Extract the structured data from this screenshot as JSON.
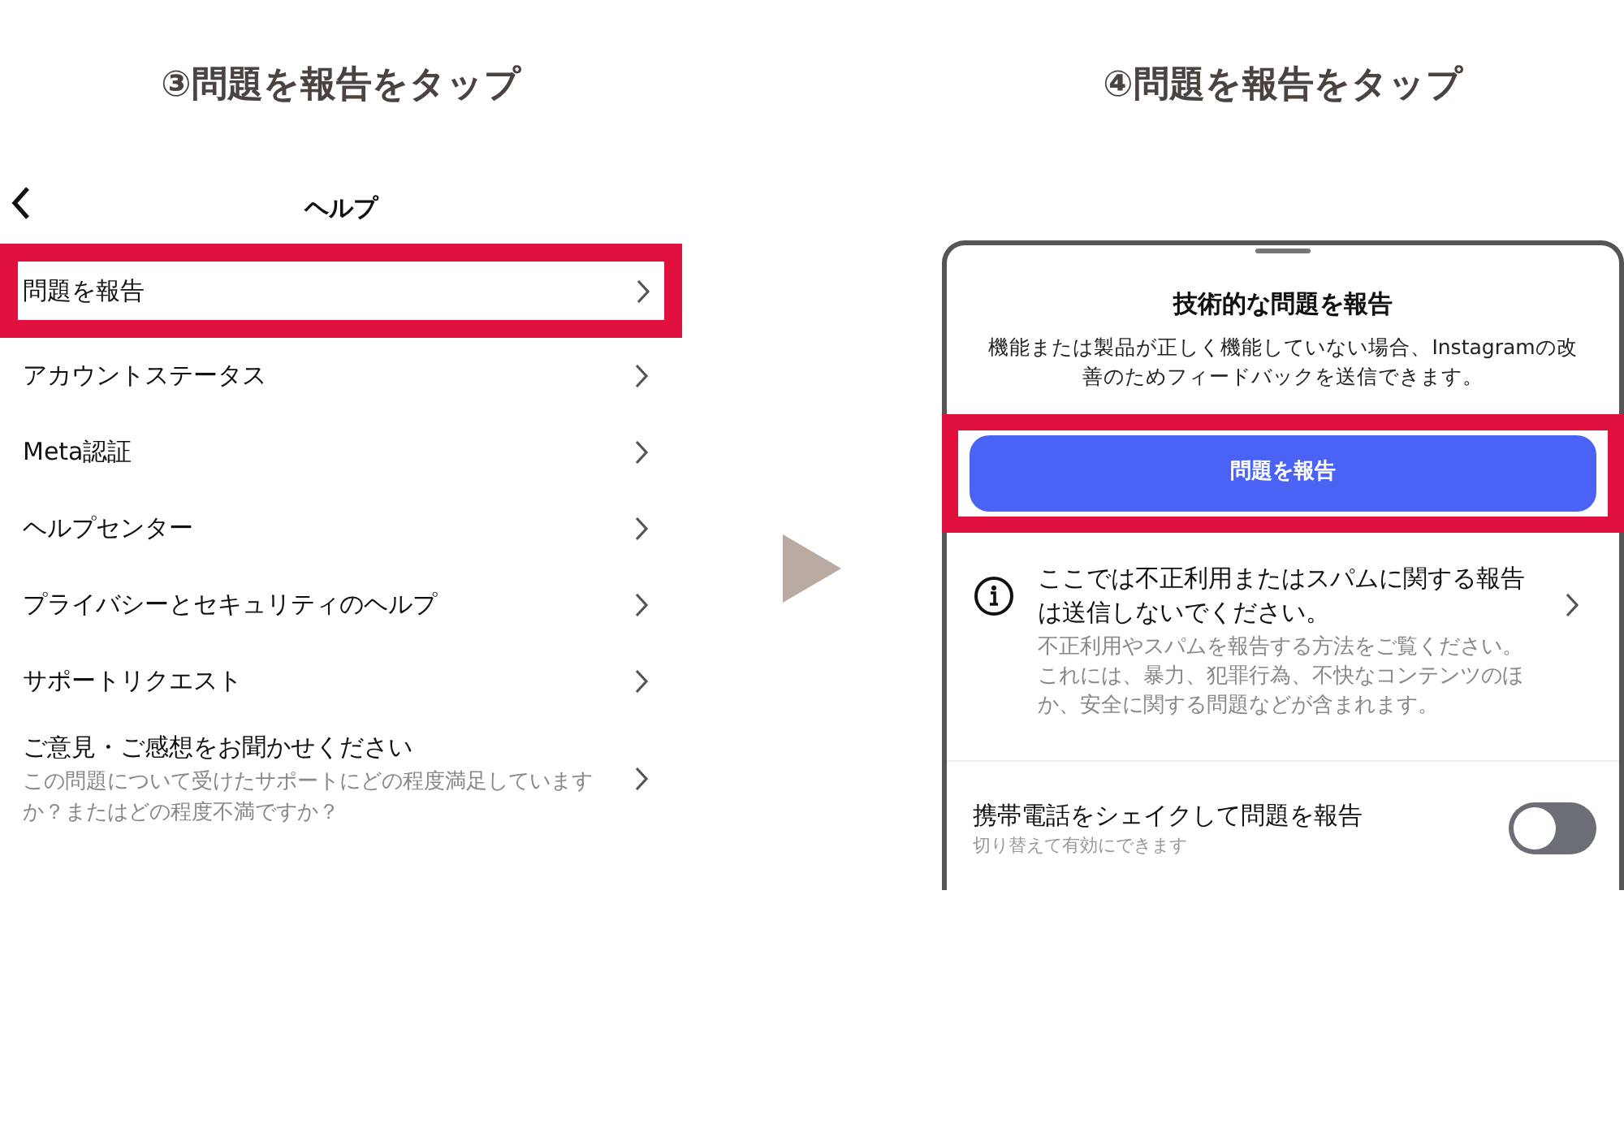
{
  "left": {
    "heading": "③問題を報告をタップ",
    "title": "ヘルプ",
    "items": [
      {
        "label": "問題を報告",
        "highlighted": true
      },
      {
        "label": "アカウントステータス",
        "highlighted": false
      },
      {
        "label": "Meta認証",
        "highlighted": false
      },
      {
        "label": "ヘルプセンター",
        "highlighted": false
      },
      {
        "label": "プライバシーとセキュリティのヘルプ",
        "highlighted": false
      },
      {
        "label": "サポートリクエスト",
        "highlighted": false
      },
      {
        "label": "ご意見・ご感想をお聞かせください",
        "sublabel": "この問題について受けたサポートにどの程度満足していますか？またはどの程度不満ですか？",
        "highlighted": false
      }
    ]
  },
  "right": {
    "heading": "④問題を報告をタップ",
    "title": "技術的な問題を報告",
    "description": "機能または製品が正しく機能していない場合、Instagramの改善のためフィードバックを送信できます。",
    "button": {
      "label": "問題を報告",
      "highlighted": true
    },
    "notice": {
      "title": "ここでは不正利用またはスパムに関する報告は送信しないでください。",
      "body": "不正利用やスパムを報告する方法をご覧ください。これには、暴力、犯罪行為、不快なコンテンツのほか、安全に関する問題などが含まれます。"
    },
    "shake": {
      "label": "携帯電話をシェイクして問題を報告",
      "hint": "切り替えて有効にできます",
      "on": false
    }
  }
}
